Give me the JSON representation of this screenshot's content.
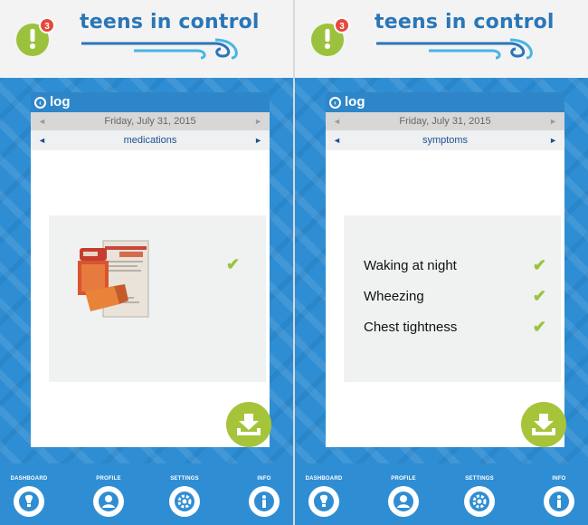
{
  "app": {
    "brand": "teens in control",
    "notification_count": "3"
  },
  "colors": {
    "brand_blue": "#2f8ed3",
    "header_bar": "#2e86c8",
    "check_green": "#9bc23c",
    "save_green": "#a6c43a",
    "category_text": "#1d4f91"
  },
  "screens": [
    {
      "log_title": "log",
      "date": "Friday, July 31, 2015",
      "category": "medications",
      "medication": {
        "image": "inhaler-with-box-icon",
        "checked": true
      }
    },
    {
      "log_title": "log",
      "date": "Friday, July 31, 2015",
      "category": "symptoms",
      "symptoms": [
        {
          "label": "Waking at night",
          "checked": true
        },
        {
          "label": "Wheezing",
          "checked": true
        },
        {
          "label": "Chest tightness",
          "checked": true
        }
      ]
    }
  ],
  "nav": [
    {
      "label": "DASHBOARD",
      "icon": "lightbulb-icon"
    },
    {
      "label": "PROFILE",
      "icon": "person-icon"
    },
    {
      "label": "SETTINGS",
      "icon": "gear-icon"
    },
    {
      "label": "INFO",
      "icon": "info-icon"
    }
  ],
  "glyphs": {
    "check": "✔",
    "arrow_left": "◄",
    "arrow_right": "►",
    "back": "‹"
  }
}
